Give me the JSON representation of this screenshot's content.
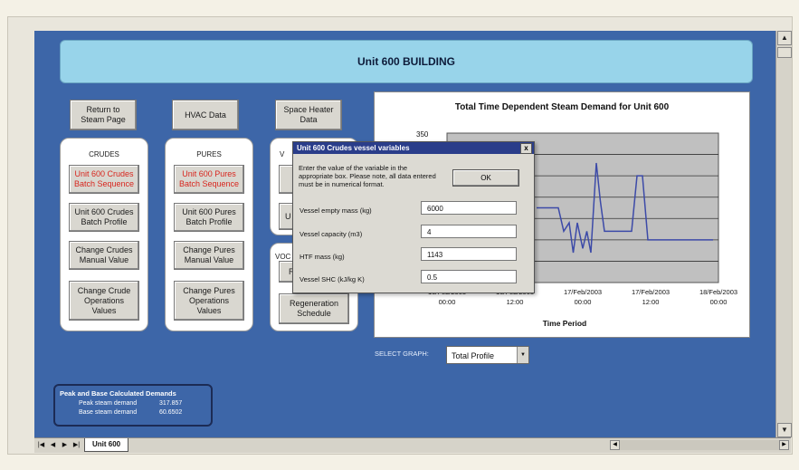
{
  "title": "Unit 600 BUILDING",
  "top_buttons": {
    "return": "Return to\nSteam Page",
    "hvac": "HVAC Data",
    "space_heater": "Space Heater\nData"
  },
  "crudes": {
    "label": "CRUDES",
    "batch_sequence": "Unit 600 Crudes\nBatch Sequence",
    "batch_profile": "Unit 600 Crudes\nBatch Profile",
    "manual_value": "Change Crudes\nManual Value",
    "operations": "Change Crude\nOperations\nValues"
  },
  "pures": {
    "label": "PURES",
    "batch_sequence": "Unit 600 Pures\nBatch Sequence",
    "batch_profile": "Unit 600 Pures\nBatch Profile",
    "manual_value": "Change Pures\nManual Value",
    "operations": "Change Pures\nOperations\nValues"
  },
  "voc": {
    "label_partial": "V",
    "button_partial": "U",
    "voc_label": "VOC",
    "r_button_partial": "R",
    "regeneration": "Regeneration\nSchedule"
  },
  "chart_data": {
    "type": "line",
    "title": "Total Time Dependent Steam Demand for Unit 600",
    "xlabel": "Time Period",
    "ylabel": "",
    "y_top_tick": "350",
    "ylim": [
      0,
      350
    ],
    "x_ticks": [
      "16/Feb/2003\n00:00",
      "16/Feb/2003\n12:00",
      "17/Feb/2003\n00:00",
      "17/Feb/2003\n12:00",
      "18/Feb/2003\n00:00"
    ],
    "series": [
      {
        "x": [
          0.66,
          0.82,
          0.86,
          0.9,
          0.93,
          0.96,
          1.0,
          1.03,
          1.06,
          1.1,
          1.13,
          1.16,
          1.2,
          1.24,
          1.28,
          1.32,
          1.36,
          1.4,
          1.44,
          1.48,
          1.52,
          1.56,
          1.6,
          1.64,
          1.68,
          1.72,
          1.76,
          1.8,
          1.84,
          1.88,
          1.92,
          1.96
        ],
        "values": [
          175,
          175,
          120,
          140,
          70,
          140,
          80,
          120,
          70,
          280,
          190,
          120,
          120,
          120,
          120,
          120,
          120,
          250,
          250,
          100,
          100,
          100,
          100,
          100,
          100,
          100,
          100,
          100,
          100,
          100,
          100,
          100
        ]
      }
    ],
    "grid": true
  },
  "dialog": {
    "title": "Unit 600 Crudes vessel variables",
    "close": "x",
    "message": "Enter the value of the variable in the appropriate box. Please note, all data entered must be in numerical format.",
    "ok": "OK",
    "fields": [
      {
        "label": "Vessel empty mass (kg)",
        "value": "6000"
      },
      {
        "label": "Vessel capacity (m3)",
        "value": "4"
      },
      {
        "label": "HTF mass (kg)",
        "value": "1143"
      },
      {
        "label": "Vessel SHC (kJ/kg K)",
        "value": "0.5"
      }
    ]
  },
  "select_graph": {
    "label": "SELECT GRAPH:",
    "value": "Total Profile"
  },
  "summary": {
    "heading": "Peak and Base Calculated Demands",
    "peak_label": "Peak steam demand",
    "peak_value": "317.857",
    "base_label": "Base steam demand",
    "base_value": "60.6502"
  },
  "sheet_tab": "Unit 600",
  "colors": {
    "sheet_bg": "#3d66a8",
    "title_bg": "#98d4ea",
    "chart_plot_bg": "#c0c0c0",
    "series_line": "#3c4aa8",
    "red_text": "#d8261e"
  }
}
